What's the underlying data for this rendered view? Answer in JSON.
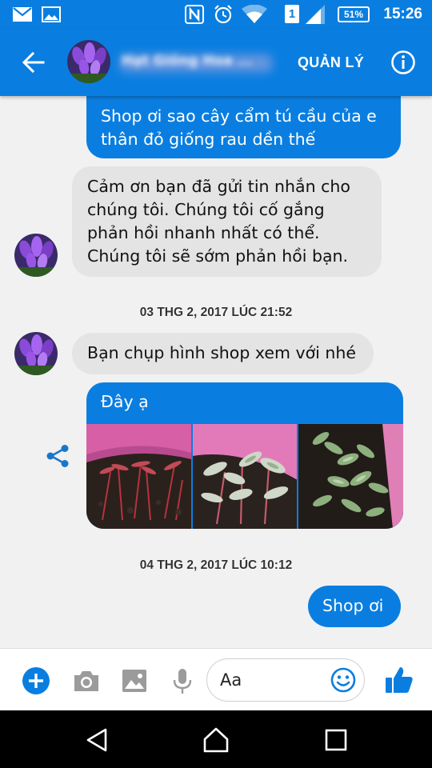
{
  "status_bar": {
    "time": "15:26",
    "battery": "51%",
    "sim": "1",
    "icons": [
      "mail-icon",
      "image-icon",
      "nfc-icon",
      "alarm-icon",
      "wifi-icon",
      "sim-icon",
      "signal-icon",
      "battery-icon"
    ]
  },
  "header": {
    "contact_name": "Hạt Giống Hoa ...",
    "manage_label": "QUẢN LÝ",
    "icons": [
      "back-arrow-icon",
      "info-icon"
    ]
  },
  "messages": [
    {
      "type": "sent",
      "text": "Shop ơi sao cây cẩm tú cầu của e thân đỏ giống rau dền thế"
    },
    {
      "type": "received",
      "text": "Cảm ơn bạn đã gửi tin nhắn cho chúng tôi. Chúng tôi cố gắng phản hồi nhanh nhất có thể. Chúng tôi sẽ sớm phản hồi bạn."
    },
    {
      "type": "timestamp",
      "text": "03 THG 2, 2017 LÚC 21:52"
    },
    {
      "type": "received",
      "text": "Bạn chụp hình shop xem với nhé"
    },
    {
      "type": "received_photos",
      "text": "Đây ạ",
      "photo_count": 3
    },
    {
      "type": "timestamp",
      "text": "04 THG 2, 2017 LÚC 10:12"
    },
    {
      "type": "sent",
      "text": "Shop ơi"
    }
  ],
  "composer": {
    "placeholder": "Aa",
    "icons": [
      "add-icon",
      "camera-icon",
      "gallery-icon",
      "microphone-icon",
      "emoji-icon",
      "thumbs-up-icon"
    ]
  },
  "colors": {
    "accent": "#0a7ee0",
    "received_bubble": "#e4e4e4",
    "background": "#f1f1f1"
  }
}
